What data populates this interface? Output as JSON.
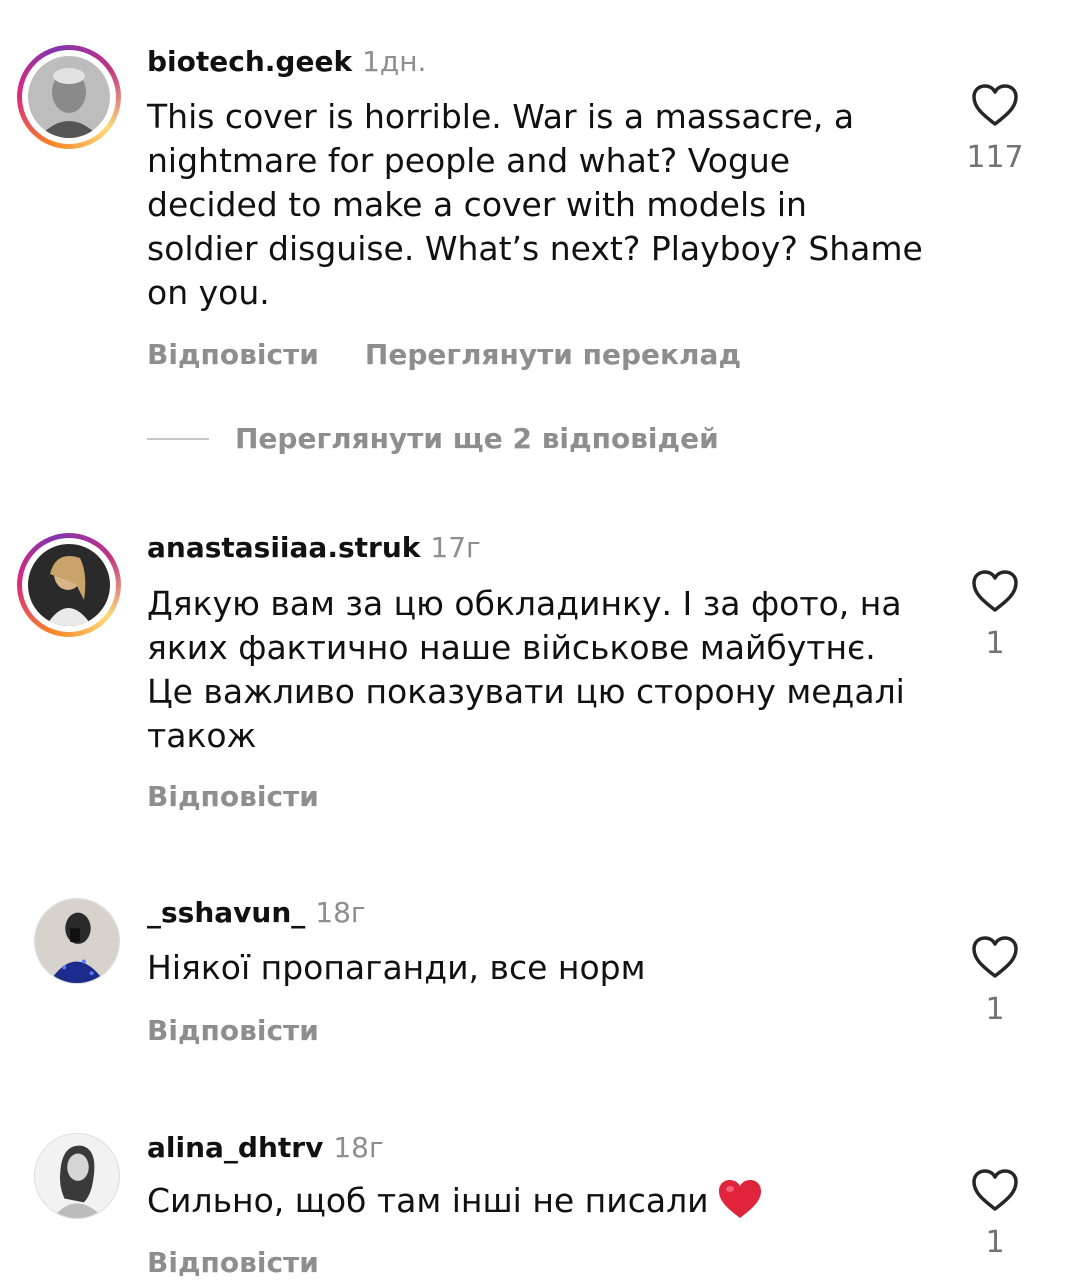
{
  "comments": [
    {
      "username": "biotech.geek",
      "time": "1дн.",
      "text": "This cover is horrible. War is a massacre, a nightmare for people and what? Vogue decided to make a cover with models in soldier disguise. What’s next? Playboy? Shame on you.",
      "reply_label": "Відповісти",
      "translate_label": "Переглянути переклад",
      "likes": "117",
      "more_replies": "Переглянути ще 2 відповідей",
      "has_story_ring": true
    },
    {
      "username": "anastasiiaa.struk",
      "time": "17г",
      "text": "Дякую вам за цю обкладинку. І за фото, на яких фактично наше військове майбутнє. Це важливо показувати цю сторону медалі також",
      "reply_label": "Відповісти",
      "likes": "1",
      "has_story_ring": true
    },
    {
      "username": "_sshavun_",
      "time": "18г",
      "text": "Ніякої пропаганди, все норм",
      "reply_label": "Відповісти",
      "likes": "1",
      "has_story_ring": false
    },
    {
      "username": "alina_dhtrv",
      "time": "18г",
      "text": "Сильно, щоб там інші не писали",
      "text_emoji": "red-heart",
      "reply_label": "Відповісти",
      "likes": "1",
      "has_story_ring": false
    }
  ],
  "colors": {
    "secondary_text": "#8e8e8e",
    "heart_outline": "#262626",
    "emoji_heart": "#e0243b"
  },
  "icons": {
    "like": "heart-outline-icon",
    "emoji": "red-heart-emoji"
  }
}
